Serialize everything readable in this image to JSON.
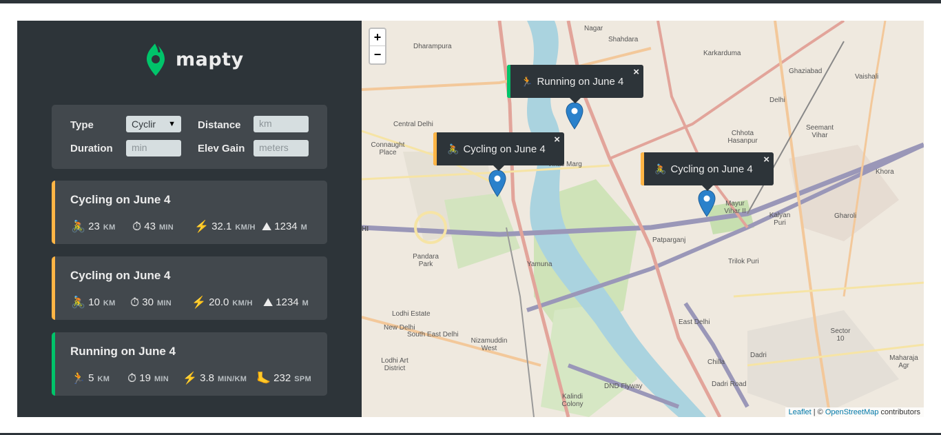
{
  "app": {
    "name": "mapty"
  },
  "colors": {
    "running": "#00c46a",
    "cycling": "#ffb545",
    "panel": "#2d3439",
    "card": "#42484d"
  },
  "form": {
    "type_label": "Type",
    "type_value": "Cyclir",
    "distance_label": "Distance",
    "distance_placeholder": "km",
    "duration_label": "Duration",
    "duration_placeholder": "min",
    "elev_label": "Elev Gain",
    "elev_placeholder": "meters"
  },
  "workouts": [
    {
      "title": "Cycling on June 4",
      "type": "cycling",
      "distance": "23",
      "distance_unit": "KM",
      "duration": "43",
      "duration_unit": "MIN",
      "speed": "32.1",
      "speed_unit": "KM/H",
      "extra": "1234",
      "extra_unit": "M"
    },
    {
      "title": "Cycling on June 4",
      "type": "cycling",
      "distance": "10",
      "distance_unit": "KM",
      "duration": "30",
      "duration_unit": "MIN",
      "speed": "20.0",
      "speed_unit": "KM/H",
      "extra": "1234",
      "extra_unit": "M"
    },
    {
      "title": "Running on June 4",
      "type": "running",
      "distance": "5",
      "distance_unit": "KM",
      "duration": "19",
      "duration_unit": "MIN",
      "speed": "3.8",
      "speed_unit": "MIN/KM",
      "extra": "232",
      "extra_unit": "SPM"
    }
  ],
  "map": {
    "zoom_in": "+",
    "zoom_out": "−",
    "popups": [
      {
        "label": "Running on June 4",
        "type": "running"
      },
      {
        "label": "Cycling on June 4",
        "type": "cycling"
      },
      {
        "label": "Cycling on June 4",
        "type": "cycling"
      }
    ],
    "close_symbol": "×",
    "attribution": {
      "leaflet": "Leaflet",
      "sep": " | © ",
      "osm": "OpenStreetMap",
      "suffix": " contributors"
    },
    "labels": [
      "Dharampura",
      "Nagar",
      "Shahdara",
      "Karkarduma",
      "Vaishali",
      "Central Delhi",
      "Connaught Place",
      "Vikas Marg",
      "Chhota Hasanpur",
      "Seemant Vihar",
      "Khora",
      "Mayur Vihar II",
      "Kalyan Puri",
      "Gharoli",
      "Patparganj",
      "Pandara Park",
      "Trilok Puri",
      "Lodhi Estate",
      "New Delhi",
      "South East Delhi",
      "Nizamuddin West",
      "Lodhi Art District",
      "Kalindi Colony",
      "DND Flyway",
      "Dadri Road",
      "Chilla",
      "Dadri",
      "Sector 10",
      "Maharaja Agr",
      "East Delhi",
      "Yamuna",
      "HI",
      "Ghaziabad",
      "Delhi"
    ]
  }
}
